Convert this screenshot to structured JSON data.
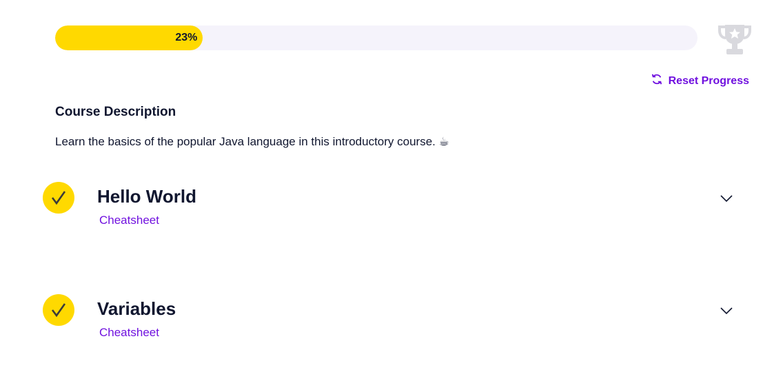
{
  "progress": {
    "percent": 23,
    "label": "23%"
  },
  "icons": {
    "trophy": "trophy-icon",
    "reset": "refresh-icon",
    "check": "checkmark-icon",
    "expand": "chevron-down-icon"
  },
  "colors": {
    "accent": "#ffd900",
    "link": "#7010df",
    "track": "#f5f3fb",
    "trophy": "#d9d9de"
  },
  "reset_label": "Reset Progress",
  "course": {
    "heading": "Course Description",
    "description": "Learn the basics of the popular Java language in this introductory course. ☕"
  },
  "modules": [
    {
      "title": "Hello World",
      "link": "Cheatsheet",
      "completed": true
    },
    {
      "title": "Variables",
      "link": "Cheatsheet",
      "completed": true
    }
  ]
}
